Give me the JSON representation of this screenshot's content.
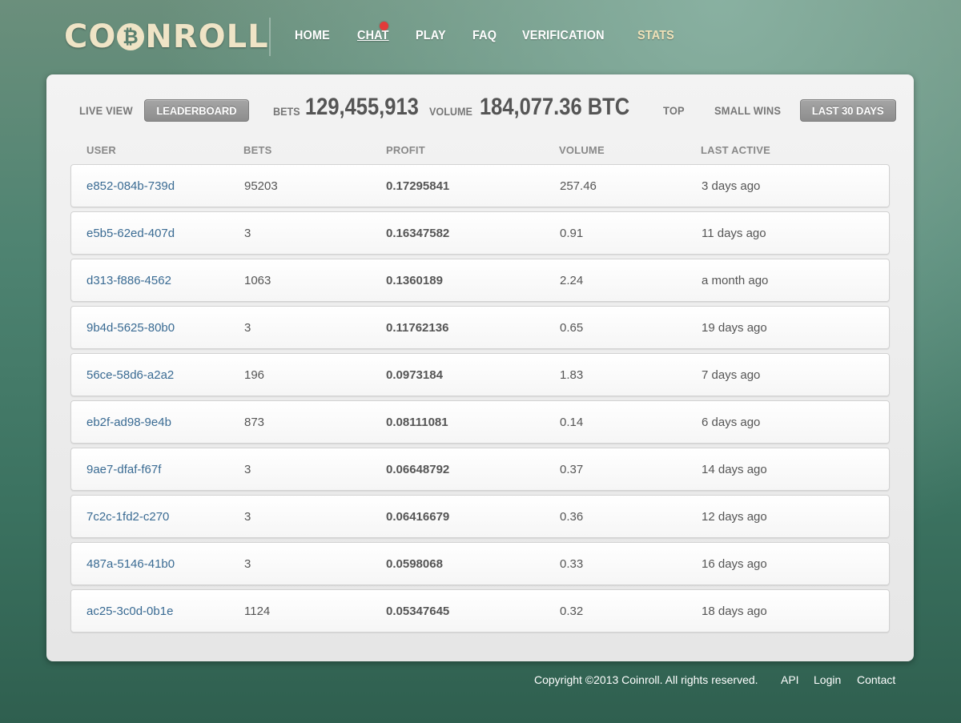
{
  "brand": {
    "logo_left": "CO",
    "logo_coin": "₿",
    "logo_right": "NROLL"
  },
  "nav": {
    "items": [
      "HOME",
      "CHAT",
      "PLAY",
      "FAQ",
      "VERIFICATION",
      "STATS"
    ]
  },
  "toolbar": {
    "live_view": "LIVE VIEW",
    "leaderboard": "LEADERBOARD",
    "bets_label": "BETS",
    "bets_value": "129,455,913",
    "volume_label": "VOLUME",
    "volume_value": "184,077.36 BTC",
    "top": "TOP",
    "small_wins": "SMALL WINS",
    "last_30_days": "LAST 30 DAYS"
  },
  "table": {
    "headers": [
      "USER",
      "BETS",
      "PROFIT",
      "VOLUME",
      "LAST ACTIVE"
    ],
    "rows": [
      [
        "e852-084b-739d",
        "95203",
        "0.17295841",
        "257.46",
        "3 days ago"
      ],
      [
        "e5b5-62ed-407d",
        "3",
        "0.16347582",
        "0.91",
        "11 days ago"
      ],
      [
        "d313-f886-4562",
        "1063",
        "0.1360189",
        "2.24",
        "a month ago"
      ],
      [
        "9b4d-5625-80b0",
        "3",
        "0.11762136",
        "0.65",
        "19 days ago"
      ],
      [
        "56ce-58d6-a2a2",
        "196",
        "0.0973184",
        "1.83",
        "7 days ago"
      ],
      [
        "eb2f-ad98-9e4b",
        "873",
        "0.08111081",
        "0.14",
        "6 days ago"
      ],
      [
        "9ae7-dfaf-f67f",
        "3",
        "0.06648792",
        "0.37",
        "14 days ago"
      ],
      [
        "7c2c-1fd2-c270",
        "3",
        "0.06416679",
        "0.36",
        "12 days ago"
      ],
      [
        "487a-5146-41b0",
        "3",
        "0.0598068",
        "0.33",
        "16 days ago"
      ],
      [
        "ac25-3c0d-0b1e",
        "1124",
        "0.05347645",
        "0.32",
        "18 days ago"
      ]
    ]
  },
  "footer": {
    "copyright": "Copyright ©2013 Coinroll. All rights reserved.",
    "api": "API",
    "login": "Login",
    "contact": "Contact"
  },
  "colors": {
    "accent_stats": "#efe1b8",
    "notification": "#e23a3a",
    "user_link": "#3a6b93"
  }
}
